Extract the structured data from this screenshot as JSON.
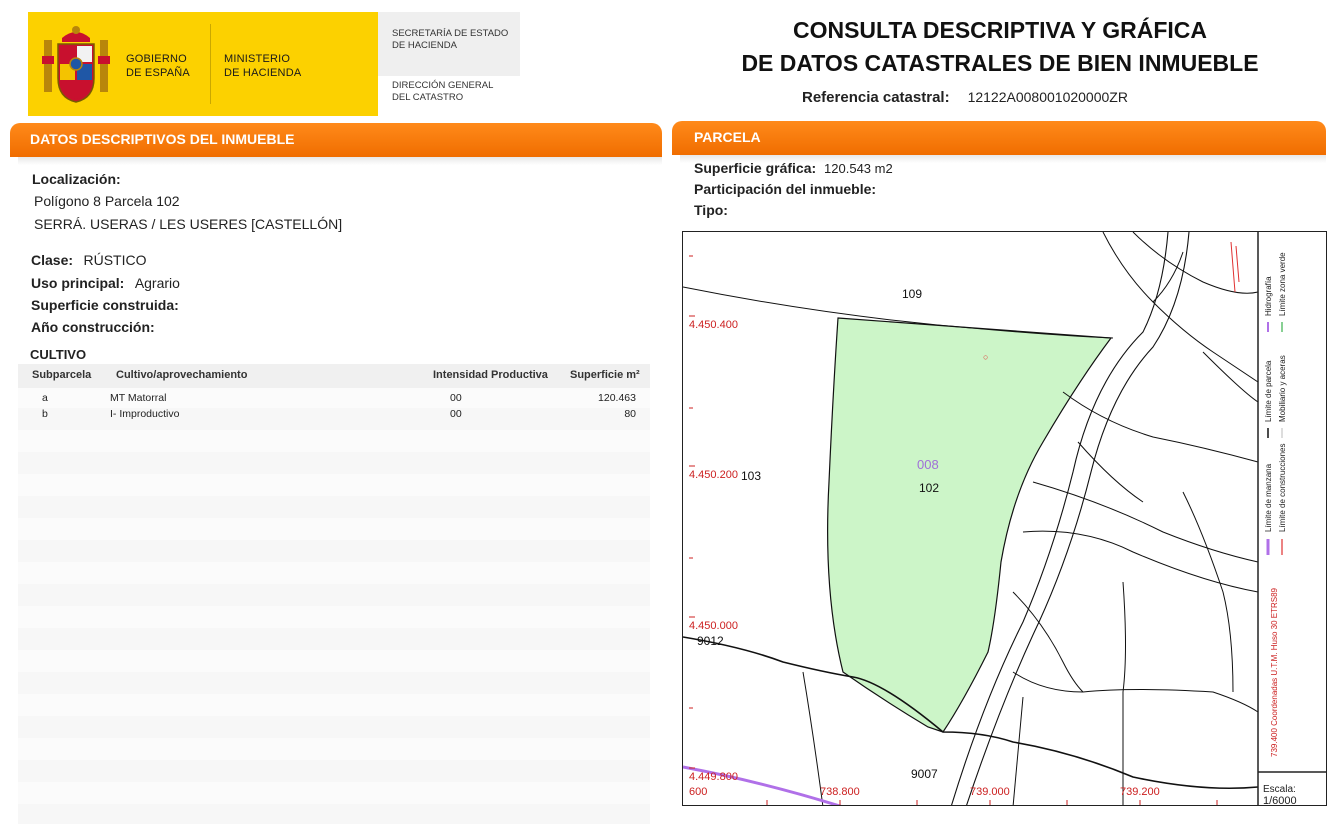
{
  "header": {
    "gobierno": [
      "GOBIERNO",
      "DE ESPAÑA"
    ],
    "ministerio": [
      "MINISTERIO",
      "DE HACIENDA"
    ],
    "secretaria": [
      "SECRETARÍA DE ESTADO",
      "DE HACIENDA"
    ],
    "direccion": [
      "DIRECCIÓN GENERAL",
      "DEL CATASTRO"
    ],
    "title_line1": "CONSULTA DESCRIPTIVA Y GRÁFICA",
    "title_line2": "DE DATOS CATASTRALES DE BIEN INMUEBLE",
    "ref_label": "Referencia catastral:",
    "ref_value": "12122A008001020000ZR"
  },
  "left_section": {
    "title": "DATOS DESCRIPTIVOS DEL INMUEBLE",
    "localizacion_label": "Localización:",
    "localizacion_line1": "Polígono 8 Parcela 102",
    "localizacion_line2": "SERRÁ. USERAS / LES USERES [CASTELLÓN]",
    "clase_label": "Clase:",
    "clase_value": "RÚSTICO",
    "uso_label": "Uso principal:",
    "uso_value": "Agrario",
    "superficie_label": "Superficie construida:",
    "anio_label": "Año construcción:",
    "cultivo": {
      "title": "CULTIVO",
      "headers": [
        "Subparcela",
        "Cultivo/aprovechamiento",
        "Intensidad Productiva",
        "Superficie m²"
      ],
      "rows": [
        [
          "a",
          "MT Matorral",
          "00",
          "120.463"
        ],
        [
          "b",
          "I- Improductivo",
          "00",
          "80"
        ]
      ]
    }
  },
  "right_section": {
    "title": "PARCELA",
    "superficie_label": "Superficie gráfica:",
    "superficie_value": "120.543 m2",
    "participacion_label": "Participación del inmueble:",
    "tipo_label": "Tipo:",
    "map": {
      "parcel_fill": "#ccf5c8",
      "labels": {
        "p109": "109",
        "p102": "102",
        "p008": "008",
        "p103": "103",
        "p9012": "9012",
        "p9007": "9007"
      },
      "y_coords": [
        "4.450.400",
        "4.450.200",
        "4.450.000",
        "4.449.800"
      ],
      "x_coords": [
        "600",
        "738.800",
        "739.000",
        "739.200"
      ],
      "legend": {
        "hidrografia": "Hidrografía",
        "zona_verde": "Límite zona verde",
        "limite_parcela": "Límite de parcela",
        "mobiliario": "Mobiliario y aceras",
        "limite_manzana": "Límite de manzana",
        "limite_construcciones": "Límite de construcciones",
        "coords_note": "739.400 Coordenadas U.T.M. Huso 30 ETRS89",
        "escala_label": "Escala:",
        "escala_value": "1/6000"
      }
    }
  }
}
